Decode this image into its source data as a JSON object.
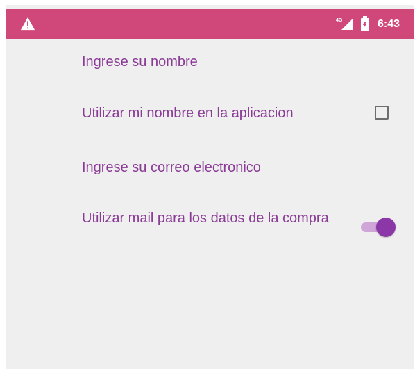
{
  "status_bar": {
    "warning_icon": "warning-triangle-icon",
    "signal_label": "4G",
    "signal_icon": "signal-strength-icon",
    "battery_icon": "battery-icon",
    "time": "6:43",
    "color": "#d0487a"
  },
  "preferences": {
    "name_label": "Ingrese su nombre",
    "use_name_label": "Utilizar mi nombre en la aplicacion",
    "use_name_checked": false,
    "email_label": "Ingrese su correo electronico",
    "use_mail_label": "Utilizar mail para los datos de la compra",
    "use_mail_enabled": true
  },
  "colors": {
    "accent": "#8a3b96",
    "switch_thumb": "#8b37a8",
    "switch_track": "#cfa6d7",
    "background": "#efefef"
  }
}
